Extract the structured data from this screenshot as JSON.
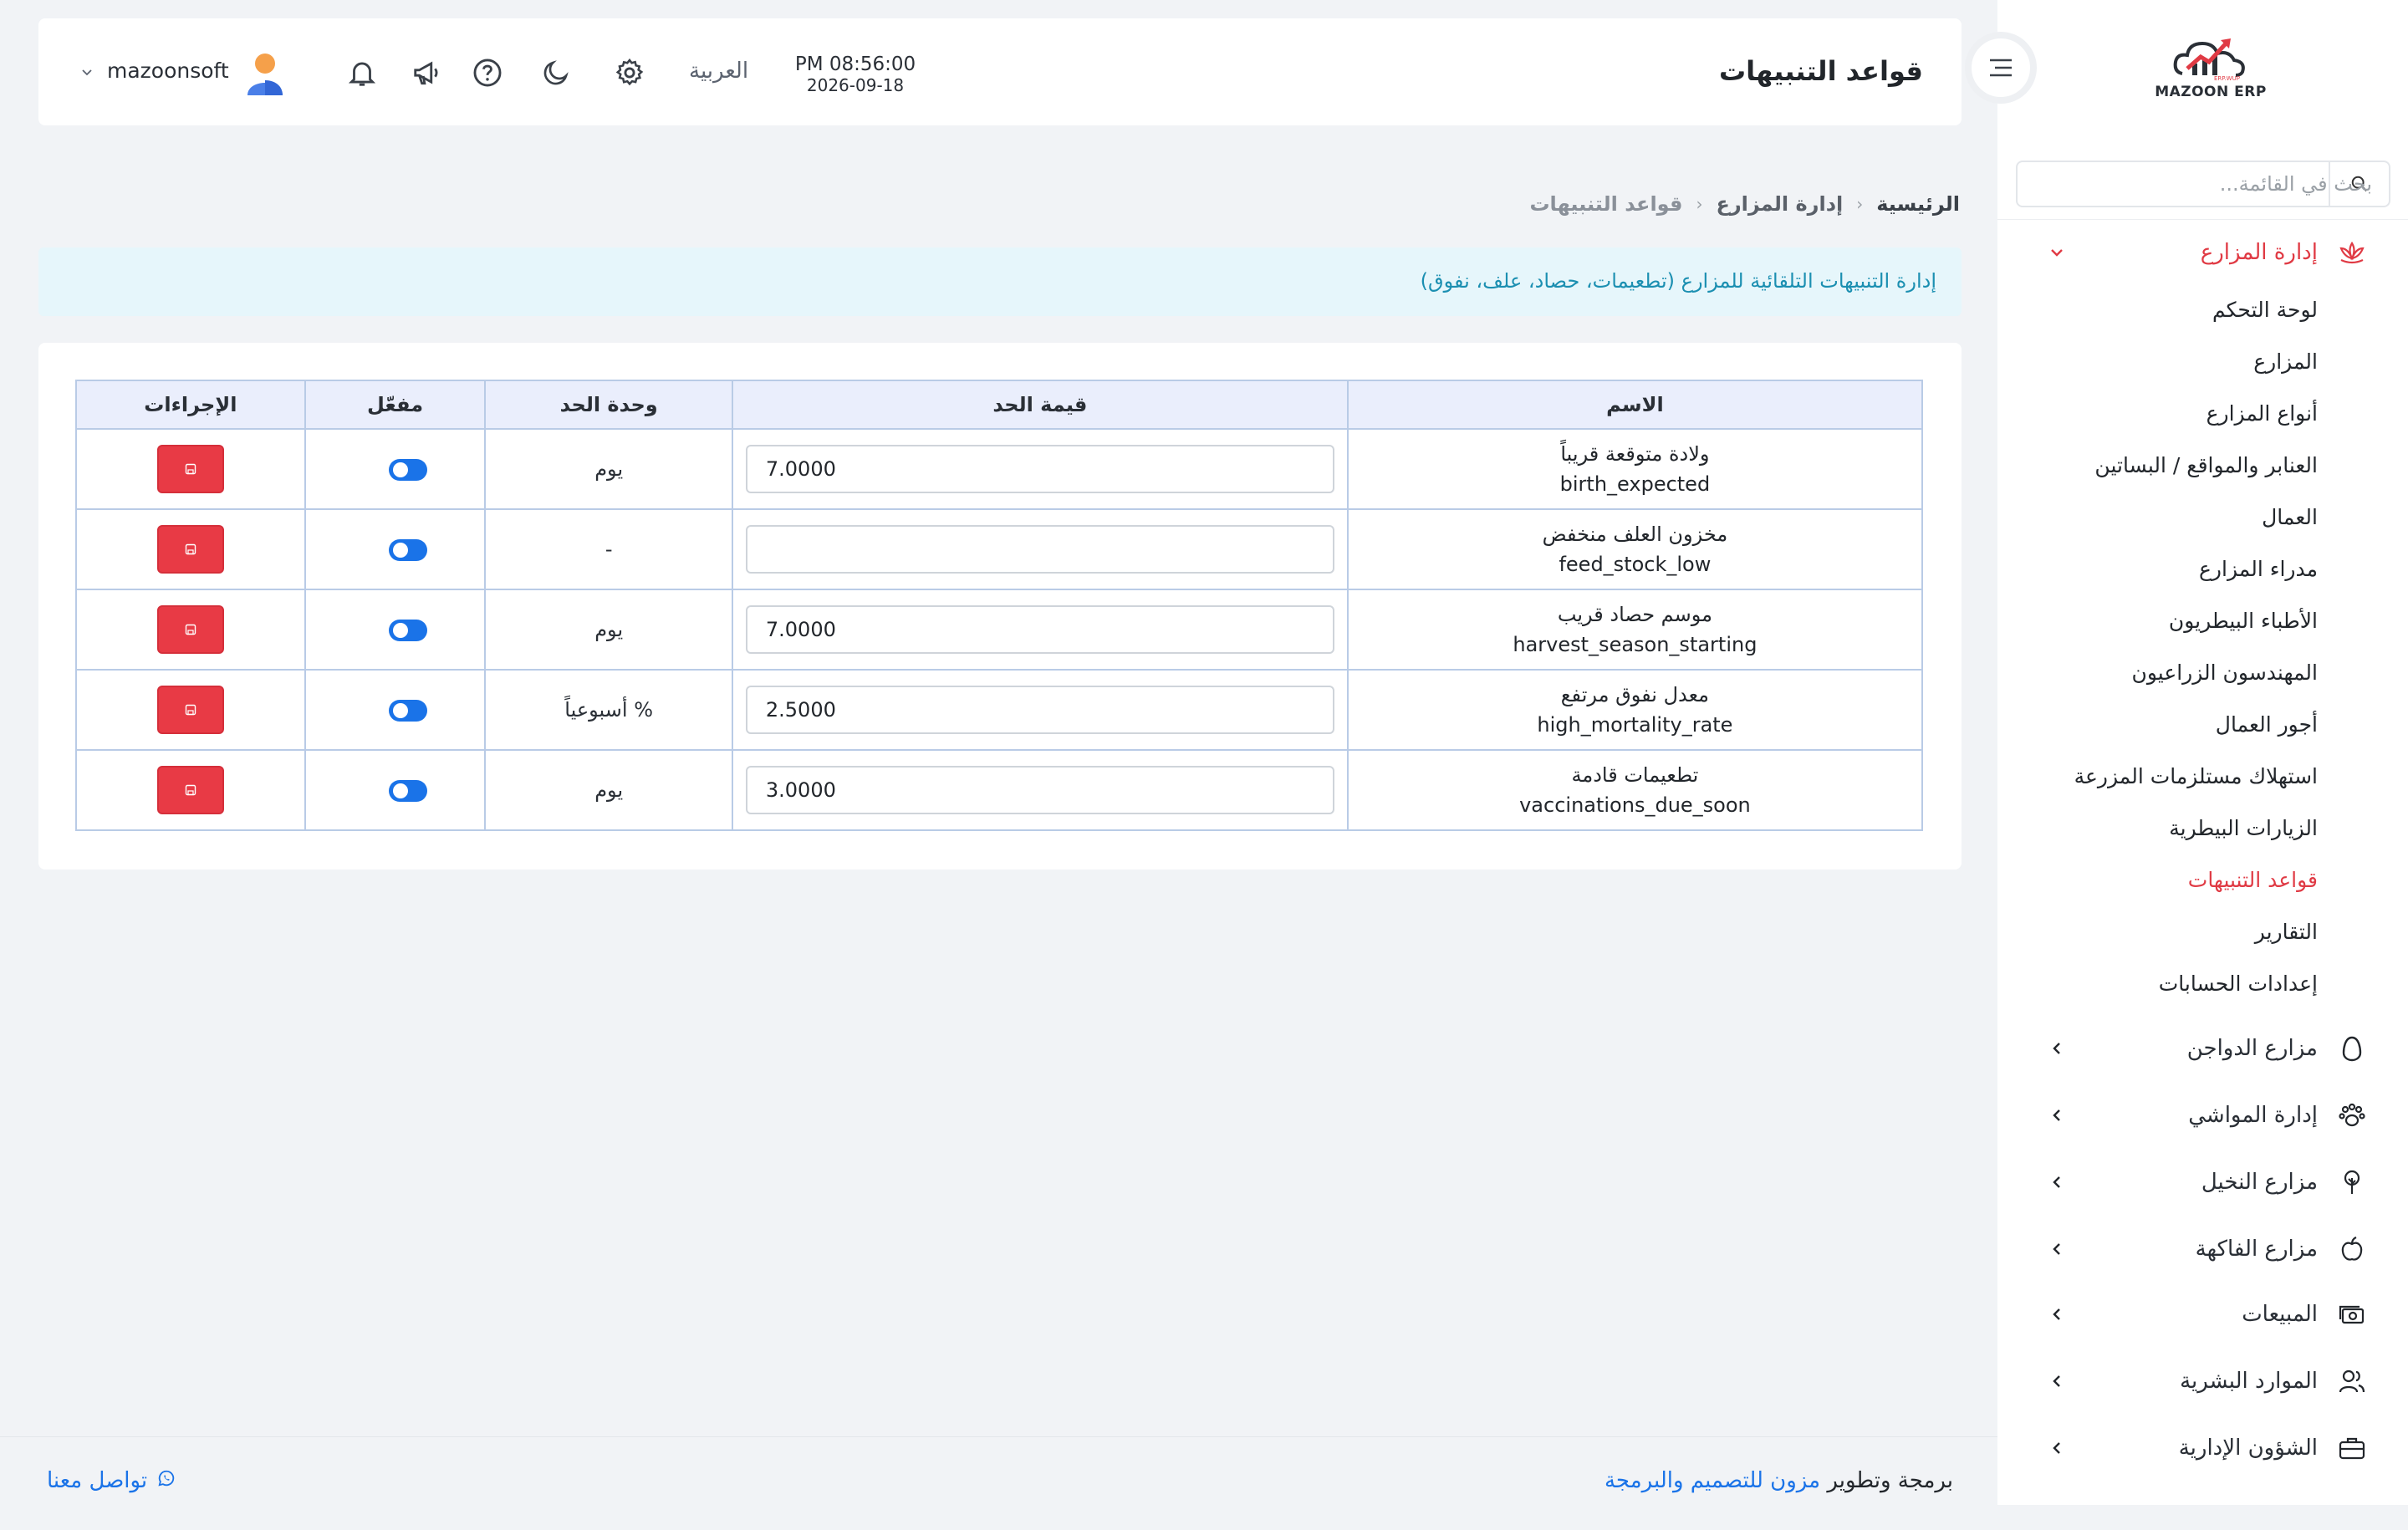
{
  "sidebar": {
    "logo_text": "MAZOON ERP",
    "search_placeholder": "بحث في القائمة...",
    "sections": [
      {
        "label": "إدارة المزارع",
        "icon": "lotus-icon",
        "expanded": true
      },
      {
        "label": "مزارع الدواجن",
        "icon": "egg-icon"
      },
      {
        "label": "إدارة المواشي",
        "icon": "paw-icon"
      },
      {
        "label": "مزارع النخيل",
        "icon": "tree-icon"
      },
      {
        "label": "مزارع الفاكهة",
        "icon": "apple-icon"
      },
      {
        "label": "المبيعات",
        "icon": "cash-icon"
      },
      {
        "label": "الموارد البشرية",
        "icon": "users-icon"
      },
      {
        "label": "الشؤون الإدارية",
        "icon": "briefcase-icon"
      }
    ],
    "sub_items": [
      "لوحة التحكم",
      "المزارع",
      "أنواع المزارع",
      "العنابر والمواقع / البساتين",
      "العمال",
      "مدراء المزارع",
      "الأطباء البيطريون",
      "المهندسون الزراعيون",
      "أجور العمال",
      "استهلاك مستلزمات المزرعة",
      "الزيارات البيطرية",
      "قواعد التنبيهات",
      "التقارير",
      "إعدادات الحسابات"
    ],
    "active_sub_index": 11
  },
  "topbar": {
    "title": "قواعد التنبيهات",
    "time": "PM 08:56:00",
    "date": "2026-09-18",
    "language": "العربية",
    "username": "mazoonsoft"
  },
  "breadcrumb": {
    "home": "الرئيسية",
    "section": "إدارة المزارع",
    "current": "قواعد التنبيهات"
  },
  "info_banner": "إدارة التنبيهات التلقائية للمزارع (تطعيمات، حصاد، علف، نفوق)",
  "table": {
    "headers": {
      "name": "الاسم",
      "value": "قيمة الحد",
      "unit": "وحدة الحد",
      "enabled": "مفعّل",
      "actions": "الإجراءات"
    },
    "rows": [
      {
        "name": "ولادة متوقعة قريباً",
        "code": "birth_expected",
        "value": "7.0000",
        "unit": "يوم",
        "enabled": true
      },
      {
        "name": "مخزون العلف منخفض",
        "code": "feed_stock_low",
        "value": "",
        "unit": "-",
        "enabled": true
      },
      {
        "name": "موسم حصاد قريب",
        "code": "harvest_season_starting",
        "value": "7.0000",
        "unit": "يوم",
        "enabled": true
      },
      {
        "name": "معدل نفوق مرتفع",
        "code": "high_mortality_rate",
        "value": "2.5000",
        "unit": "% أسبوعياً",
        "enabled": true
      },
      {
        "name": "تطعيمات قادمة",
        "code": "vaccinations_due_soon",
        "value": "3.0000",
        "unit": "يوم",
        "enabled": true
      }
    ]
  },
  "footer": {
    "credit_prefix": "برمجة وتطوير",
    "credit_brand": "مزون للتصميم والبرمجة",
    "contact": "تواصل معنا"
  },
  "colors": {
    "accent": "#e03a44",
    "primary": "#1a73e8",
    "info_text": "#1b8fb1",
    "info_bg": "#e6f6fb",
    "table_head": "#eaeefc",
    "table_border": "#b9cbe6"
  }
}
